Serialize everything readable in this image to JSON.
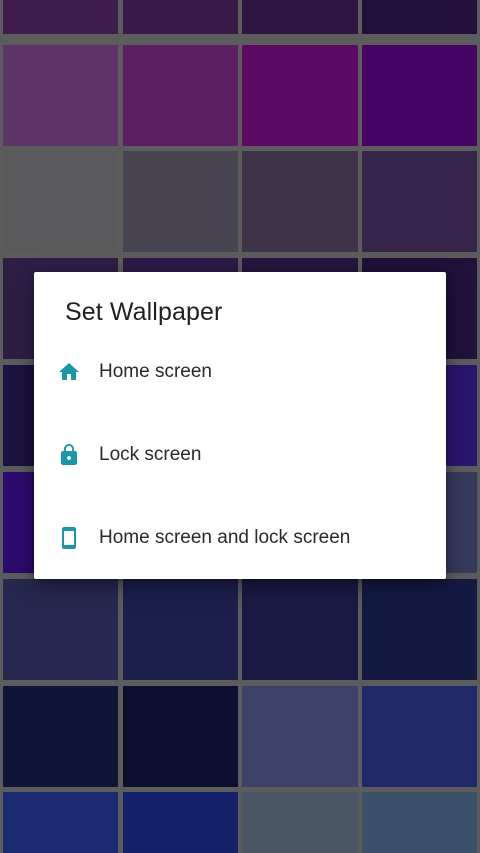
{
  "colors": {
    "accent": "#1b97a8",
    "grid_gap": "#5c5c5c",
    "dialog_bg": "#ffffff",
    "swatches": [
      [
        "#3e1d4c",
        "#3a1948",
        "#2e1440",
        "#23103a"
      ],
      [
        "#5e3368",
        "#5c1f62",
        "#5b0962",
        "#430464"
      ],
      [
        "#5a5a5c",
        "#484452",
        "#3f334a",
        "#36244b"
      ],
      [
        "#2e1e45",
        "#2d1a47",
        "#251640",
        "#1f113a"
      ],
      [
        "#1c1240",
        "#1f1446",
        "#231a55",
        "#2a1570"
      ],
      [
        "#2d0a6d",
        "#2f0b70",
        "#3a3460",
        "#363a5c"
      ],
      [
        "#27284f",
        "#1c1f4b",
        "#1a1a44",
        "#151a42"
      ],
      [
        "#101637",
        "#0d0f30",
        "#3c4168",
        "#1f2868"
      ],
      [
        "#1a2a70",
        "#13206a",
        "#4c5766",
        "#3a5068"
      ]
    ]
  },
  "dialog": {
    "title": "Set Wallpaper",
    "options": [
      {
        "label": "Home screen",
        "icon": "home-icon"
      },
      {
        "label": "Lock screen",
        "icon": "lock-icon"
      },
      {
        "label": "Home screen and lock screen",
        "icon": "smartphone-icon"
      }
    ]
  }
}
